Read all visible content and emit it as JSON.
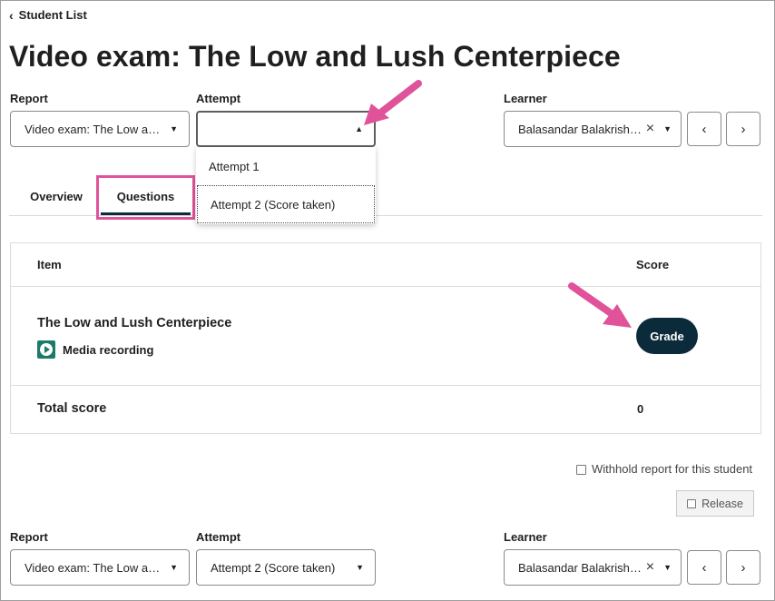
{
  "header": {
    "back_label": "Student List",
    "title": "Video exam: The Low and Lush Centerpiece"
  },
  "filters_top": {
    "report_label": "Report",
    "report_value": "Video exam: The Low and Lush Centerpiece",
    "attempt_label": "Attempt",
    "attempt_value": "",
    "learner_label": "Learner",
    "learner_value": "Balasandar Balakrishnan"
  },
  "attempt_dropdown": {
    "options": [
      "Attempt 1",
      "Attempt 2 (Score taken)"
    ]
  },
  "tabs": {
    "overview": "Overview",
    "questions": "Questions"
  },
  "table": {
    "col_item": "Item",
    "col_score": "Score",
    "item_title": "The Low and Lush Centerpiece",
    "item_type": "Media recording",
    "grade_label": "Grade",
    "total_label": "Total score",
    "total_value": "0"
  },
  "actions": {
    "withhold_label": "Withhold report for this student",
    "release_label": "Release"
  },
  "filters_bottom": {
    "report_label": "Report",
    "report_value": "Video exam: The Low and Lush Centerpiece",
    "attempt_label": "Attempt",
    "attempt_value": "Attempt 2 (Score taken)",
    "learner_label": "Learner",
    "learner_value": "Balasandar Balakrishnan"
  },
  "icons": {
    "back": "chevron-left-icon",
    "caret": "caret-down-icon",
    "caret_open": "caret-up-icon",
    "clear": "close-icon",
    "prev": "chevron-left-icon",
    "next": "chevron-right-icon",
    "media": "play-circle-icon",
    "annotation": "pink-arrow-icon"
  },
  "colors": {
    "primary": "#0b2a3a",
    "highlight": "#e0539a",
    "media_icon": "#1b7a68",
    "border": "#8a8a8a"
  }
}
